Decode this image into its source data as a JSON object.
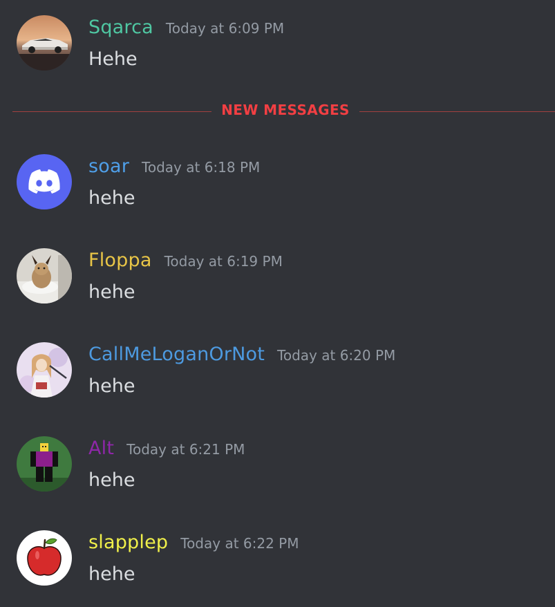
{
  "divider": {
    "label": "NEW MESSAGES"
  },
  "colors": {
    "background": "#313338",
    "timestamp": "#949ba4",
    "message_text": "#dbdee1",
    "new_messages": "#f23f43"
  },
  "messages": [
    {
      "username": "Sqarca",
      "timestamp": "Today at 6:09 PM",
      "content": "Hehe",
      "name_color": "#4fc7a2",
      "avatar": "lamborghini-car-avatar"
    },
    {
      "username": "soar",
      "timestamp": "Today at 6:18 PM",
      "content": "hehe",
      "name_color": "#4f9fe8",
      "avatar": "discord-default-avatar"
    },
    {
      "username": "Floppa",
      "timestamp": "Today at 6:19 PM",
      "content": "hehe",
      "name_color": "#e8c547",
      "avatar": "caracal-cat-avatar"
    },
    {
      "username": "CallMeLoganOrNot",
      "timestamp": "Today at 6:20 PM",
      "content": "hehe",
      "name_color": "#4d9ae0",
      "avatar": "anime-girl-avatar"
    },
    {
      "username": "Alt",
      "timestamp": "Today at 6:21 PM",
      "content": "hehe",
      "name_color": "#8e27a8",
      "avatar": "roblox-character-avatar"
    },
    {
      "username": "slapplep",
      "timestamp": "Today at 6:22 PM",
      "content": "hehe",
      "name_color": "#f0f04a",
      "avatar": "red-apple-avatar"
    }
  ]
}
